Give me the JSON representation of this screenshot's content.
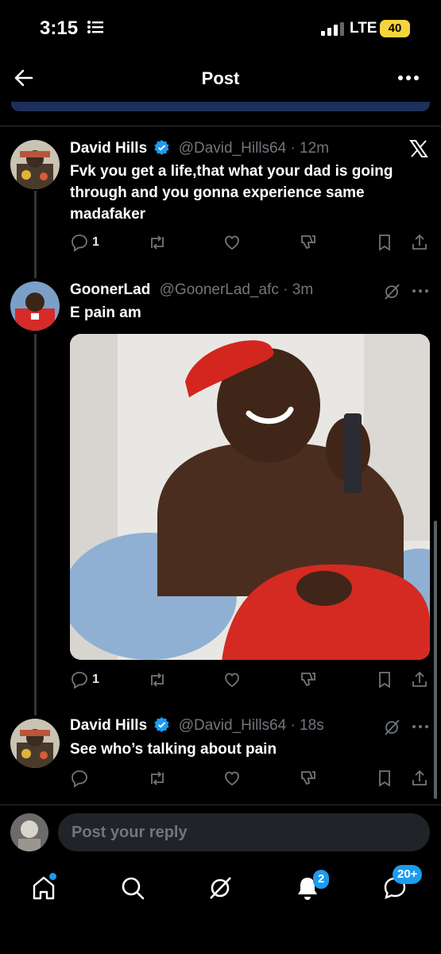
{
  "status_bar": {
    "time": "3:15",
    "network": "LTE",
    "battery": "40"
  },
  "header": {
    "title": "Post"
  },
  "tweets": [
    {
      "name": "David Hills",
      "handle": "@David_Hills64",
      "time": "· 12m",
      "text": "Fvk you get a life,that what your dad is going through and you gonna experience same madafaker",
      "replies": "1"
    },
    {
      "name": "GoonerLad",
      "handle": "@GoonerLad_afc",
      "time": "· 3m",
      "text": "E pain am",
      "replies": "1"
    },
    {
      "name": "David Hills",
      "handle": "@David_Hills64",
      "time": "· 18s",
      "text": "See who’s talking about pain",
      "replies": ""
    }
  ],
  "reply": {
    "placeholder": "Post your reply"
  },
  "tabbar": {
    "notifications_count": "2",
    "messages_count": "20+"
  },
  "colors": {
    "accent": "#1d9bf0",
    "background": "#000000",
    "muted": "#71767b",
    "battery": "#f4d43c"
  }
}
